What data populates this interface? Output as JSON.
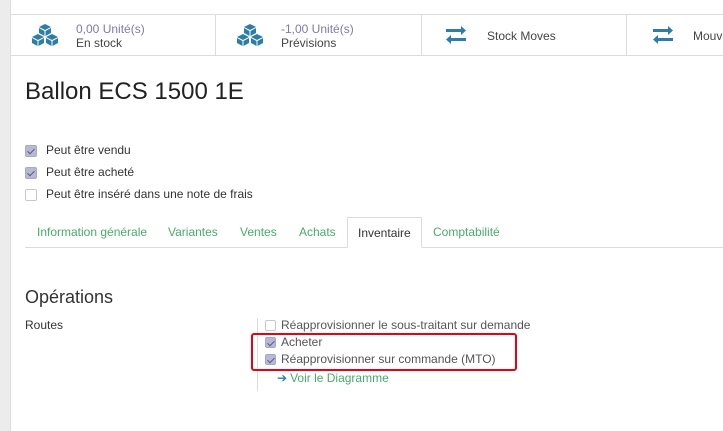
{
  "stat_buttons": [
    {
      "value": "0,00 Unité(s)",
      "label": "En stock",
      "icon": "cubes-icon"
    },
    {
      "value": "-1,00 Unité(s)",
      "label": "Prévisions",
      "icon": "cubes-icon"
    },
    {
      "label": "Stock Moves",
      "icon": "exchange-icon"
    },
    {
      "label": "Mouve",
      "icon": "exchange-icon"
    }
  ],
  "product": {
    "title": "Ballon ECS 1500 1E"
  },
  "checkboxes": [
    {
      "label": "Peut être vendu",
      "checked": true
    },
    {
      "label": "Peut être acheté",
      "checked": true
    },
    {
      "label": "Peut être inséré dans une note de frais",
      "checked": false
    }
  ],
  "tabs": [
    {
      "label": "Information générale",
      "active": false
    },
    {
      "label": "Variantes",
      "active": false
    },
    {
      "label": "Ventes",
      "active": false
    },
    {
      "label": "Achats",
      "active": false
    },
    {
      "label": "Inventaire",
      "active": true
    },
    {
      "label": "Comptabilité",
      "active": false
    }
  ],
  "operations": {
    "section_title": "Opérations",
    "routes_label": "Routes",
    "routes": [
      {
        "label": "Réapprovisionner le sous-traitant sur demande",
        "checked": false
      },
      {
        "label": "Acheter",
        "checked": true
      },
      {
        "label": "Réapprovisionner sur commande (MTO)",
        "checked": true
      }
    ],
    "diagram_link": "Voir le Diagramme"
  },
  "colors": {
    "accent": "#7c7bad",
    "link": "#49ab6b",
    "highlight": "#e6001a",
    "icon": "#2e7da6"
  }
}
